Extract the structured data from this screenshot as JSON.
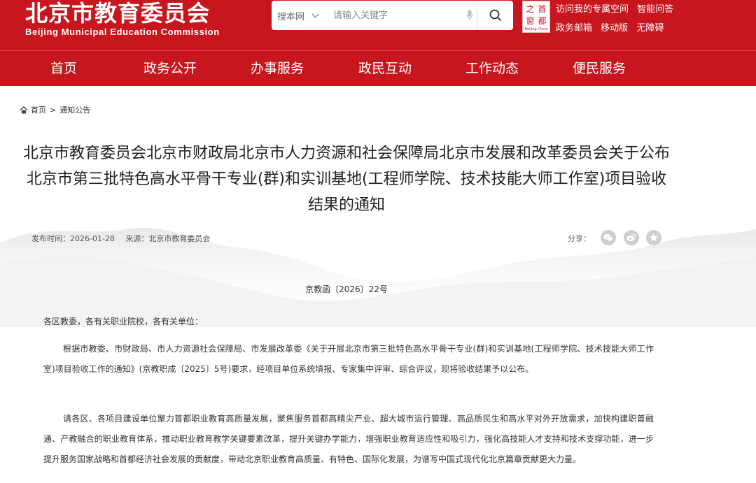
{
  "header": {
    "site_name_cn": "北京市教育委员会",
    "site_name_en": "Beijing Municipal Education Commission",
    "search": {
      "scope": "搜本网",
      "placeholder": "请输入关键字"
    },
    "seal": {
      "chars": [
        "首",
        "都",
        "之",
        "窗"
      ],
      "en": "Beijing·China"
    },
    "links_row1": [
      "访问我的专属空间",
      "智能问答"
    ],
    "links_row2": [
      "政务邮箱",
      "移动版",
      "无障碍"
    ]
  },
  "nav": {
    "items": [
      "首页",
      "政务公开",
      "办事服务",
      "政民互动",
      "工作动态",
      "便民服务"
    ]
  },
  "breadcrumb": {
    "home": "首页",
    "sep": ">",
    "current": "通知公告"
  },
  "article": {
    "title": "北京市教育委员会北京市财政局北京市人力资源和社会保障局北京市发展和改革委员会关于公布北京市第三批特色高水平骨干专业(群)和实训基地(工程师学院、技术技能大师工作室)项目验收结果的通知",
    "publish_time": "发布时间：2026-01-28",
    "source": "来源：北京市教育委员会",
    "share_label": "分享：",
    "share_icons": [
      "wechat-icon",
      "weibo-icon",
      "favorite-icon"
    ],
    "doc_no": "京教函〔2026〕22号",
    "salutation": "各区教委，各有关职业院校，各有关单位：",
    "paragraphs": [
      "根据市教委、市财政局、市人力资源社会保障局、市发展改革委《关于开展北京市第三批特色高水平骨干专业(群)和实训基地(工程师学院、技术技能大师工作室)项目验收工作的通知》(京教职成〔2025〕5号)要求，经项目单位系统填报、专家集中评审、综合评议，现将验收结果予以公布。",
      "请各区、各项目建设单位聚力首都职业教育高质量发展，聚焦服务首都高精尖产业、超大城市运行管理、高品质民生和高水平对外开放需求，加快构建职普融通、产教融合的职业教育体系，推动职业教育教学关键要素改革，提升关键办学能力，增强职业教育适应性和吸引力，强化高技能人才支持和技术支撑功能，进一步提升服务国家战略和首都经济社会发展的贡献度，带动北京职业教育高质量、有特色、国际化发展，为谱写中国式现代化北京篇章贡献更大力量。"
    ]
  },
  "colors": {
    "brand_red": "#c8161e"
  }
}
